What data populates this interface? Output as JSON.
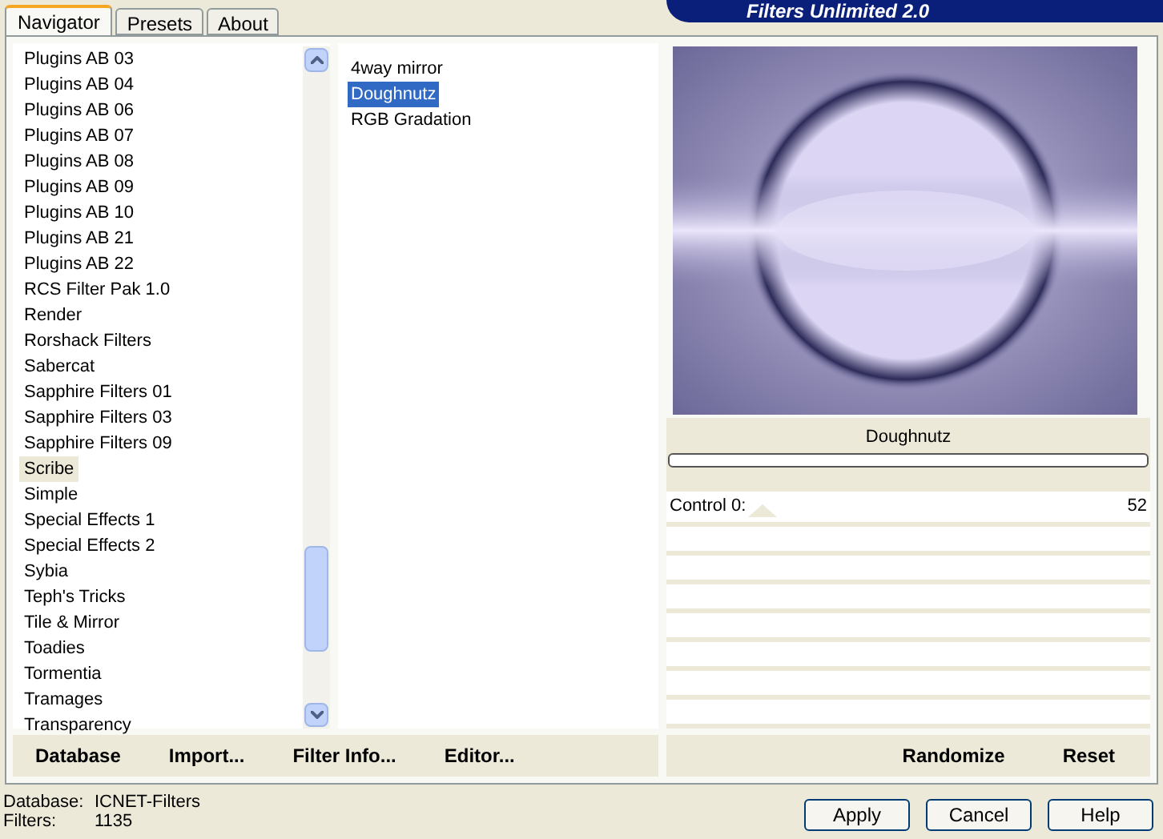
{
  "logo": "Filters Unlimited 2.0",
  "tabs": [
    {
      "label": "Navigator",
      "selected": true
    },
    {
      "label": "Presets",
      "selected": false
    },
    {
      "label": "About",
      "selected": false
    }
  ],
  "categories": [
    {
      "label": "Plugins AB 03",
      "selected": false
    },
    {
      "label": "Plugins AB 04",
      "selected": false
    },
    {
      "label": "Plugins AB 06",
      "selected": false
    },
    {
      "label": "Plugins AB 07",
      "selected": false
    },
    {
      "label": "Plugins AB 08",
      "selected": false
    },
    {
      "label": "Plugins AB 09",
      "selected": false
    },
    {
      "label": "Plugins AB 10",
      "selected": false
    },
    {
      "label": "Plugins AB 21",
      "selected": false
    },
    {
      "label": "Plugins AB 22",
      "selected": false
    },
    {
      "label": "RCS Filter Pak 1.0",
      "selected": false
    },
    {
      "label": "Render",
      "selected": false
    },
    {
      "label": "Rorshack Filters",
      "selected": false
    },
    {
      "label": "Sabercat",
      "selected": false
    },
    {
      "label": "Sapphire Filters 01",
      "selected": false
    },
    {
      "label": "Sapphire Filters 03",
      "selected": false
    },
    {
      "label": "Sapphire Filters 09",
      "selected": false
    },
    {
      "label": "Scribe",
      "selected": true
    },
    {
      "label": "Simple",
      "selected": false
    },
    {
      "label": "Special Effects 1",
      "selected": false
    },
    {
      "label": "Special Effects 2",
      "selected": false
    },
    {
      "label": "Sybia",
      "selected": false
    },
    {
      "label": "Teph's Tricks",
      "selected": false
    },
    {
      "label": "Tile & Mirror",
      "selected": false
    },
    {
      "label": "Toadies",
      "selected": false
    },
    {
      "label": "Tormentia",
      "selected": false
    },
    {
      "label": "Tramages",
      "selected": false
    },
    {
      "label": "Transparency",
      "selected": false
    }
  ],
  "filters": [
    {
      "label": "4way mirror",
      "selected": false
    },
    {
      "label": "Doughnutz",
      "selected": true
    },
    {
      "label": "RGB Gradation",
      "selected": false
    }
  ],
  "preview": {
    "filter_name": "Doughnutz",
    "progress": {
      "level": 0
    }
  },
  "controls": [
    {
      "label": "Control 0:",
      "value": "52",
      "level": 0.2
    }
  ],
  "left_buttons": [
    "Database",
    "Import...",
    "Filter Info...",
    "Editor..."
  ],
  "right_buttons": [
    "Randomize",
    "Reset"
  ],
  "status": [
    {
      "label": "Database:",
      "value": "ICNET-Filters"
    },
    {
      "label": "Filters:",
      "value": "1135"
    }
  ],
  "dialog_buttons": [
    "Apply",
    "Cancel",
    "Help"
  ]
}
